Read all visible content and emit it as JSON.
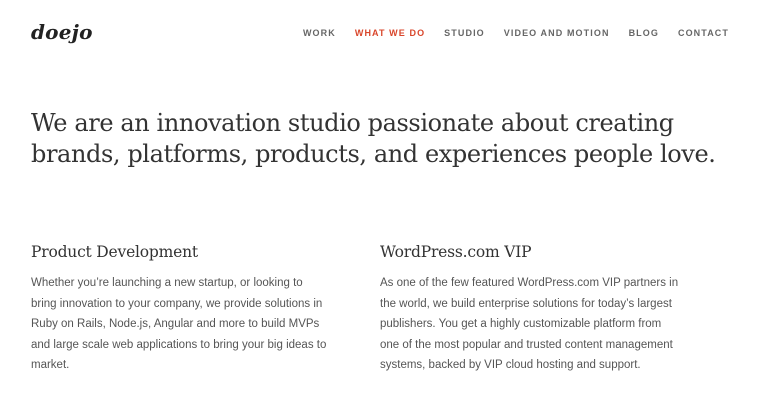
{
  "header": {
    "logo": "doejo",
    "nav": [
      {
        "label": "WORK",
        "active": false
      },
      {
        "label": "WHAT WE DO",
        "active": true
      },
      {
        "label": "STUDIO",
        "active": false
      },
      {
        "label": "VIDEO AND MOTION",
        "active": false
      },
      {
        "label": "BLOG",
        "active": false
      },
      {
        "label": "CONTACT",
        "active": false
      }
    ]
  },
  "hero": {
    "line1": "We are an innovation studio passionate about creating",
    "line2": "brands, platforms, products, and experiences people love."
  },
  "services": [
    {
      "title": "Product Development",
      "body": "Whether you’re launching a new startup, or looking to bring innovation to your company, we provide solutions in Ruby on Rails, Node.js, Angular and more to build MVPs and large scale web applications to bring your big ideas to market."
    },
    {
      "title": "WordPress.com VIP",
      "body": "As one of the few featured WordPress.com VIP partners in the world, we build enterprise solutions for today’s largest publishers. You get a highly customizable platform from one of the most popular and trusted content management systems, backed by VIP cloud hosting and support."
    }
  ],
  "colors": {
    "accent": "#d9462b",
    "text": "#333333",
    "nav": "#666666",
    "background": "#ffffff"
  }
}
